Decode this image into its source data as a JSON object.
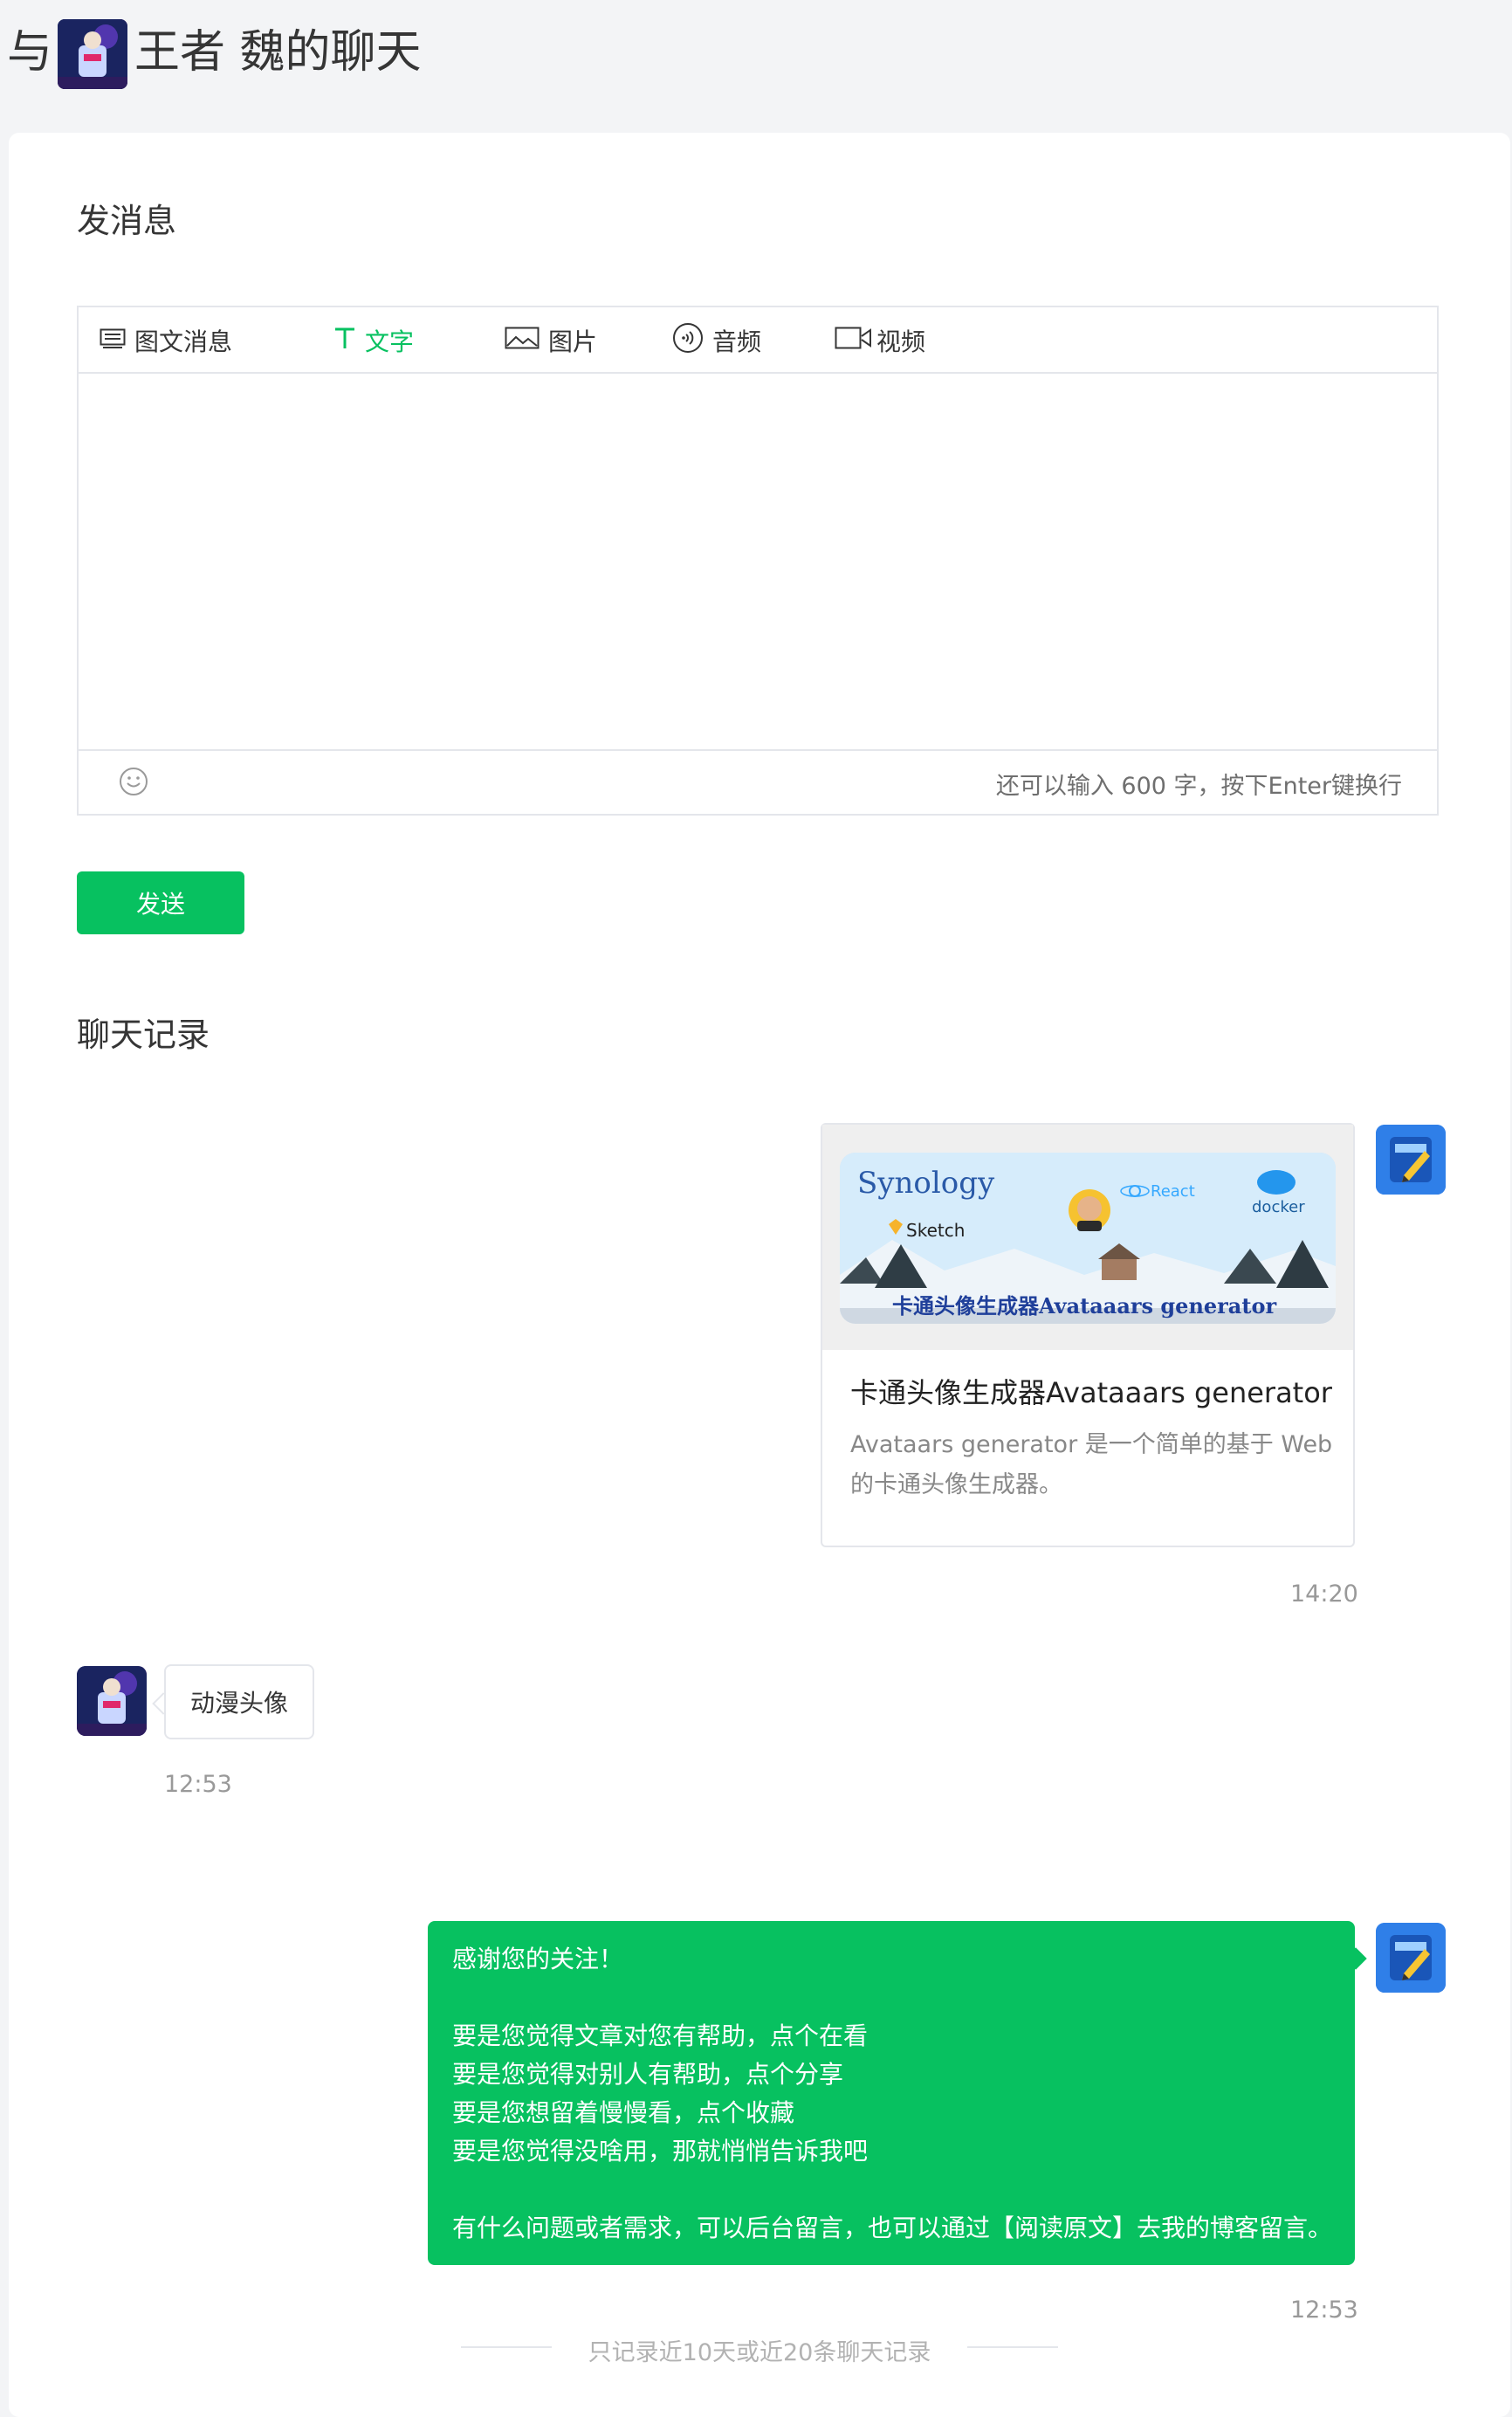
{
  "header": {
    "prefix": "与",
    "name": "王者 魏的聊天"
  },
  "compose": {
    "section_title": "发消息",
    "tabs": [
      {
        "label": "图文消息",
        "icon": "article-icon"
      },
      {
        "label": "文字",
        "icon": "text-icon",
        "active": true
      },
      {
        "label": "图片",
        "icon": "image-icon"
      },
      {
        "label": "音频",
        "icon": "audio-icon"
      },
      {
        "label": "视频",
        "icon": "video-icon"
      }
    ],
    "counter": "还可以输入 600 字，按下Enter键换行",
    "send_label": "发送"
  },
  "history": {
    "section_title": "聊天记录",
    "article": {
      "cover_text_synology": "Synology",
      "cover_text_sketch": "Sketch",
      "cover_text_react": "React",
      "cover_text_docker": "docker",
      "cover_text_banner": "卡通头像生成器Avataaars generator",
      "title": "卡通头像生成器Avataaars generator",
      "desc": "Avataars generator 是一个简单的基于 Web 的卡通头像生成器。",
      "time": "14:20"
    },
    "incoming": {
      "text": "动漫头像",
      "time": "12:53"
    },
    "reply": {
      "line1": "感谢您的关注！",
      "line2": "要是您觉得文章对您有帮助，点个在看",
      "line3": "要是您觉得对别人有帮助，点个分享",
      "line4": "要是您想留着慢慢看，点个收藏",
      "line5": "要是您觉得没啥用，那就悄悄告诉我吧",
      "line6": "有什么问题或者需求，可以后台留言，也可以通过【阅读原文】去我的博客留言。",
      "time": "12:53"
    },
    "footer_note": "只记录近10天或近20条聊天记录"
  },
  "colors": {
    "accent": "#07c160",
    "border": "#e4e6eb",
    "muted": "#999999"
  }
}
